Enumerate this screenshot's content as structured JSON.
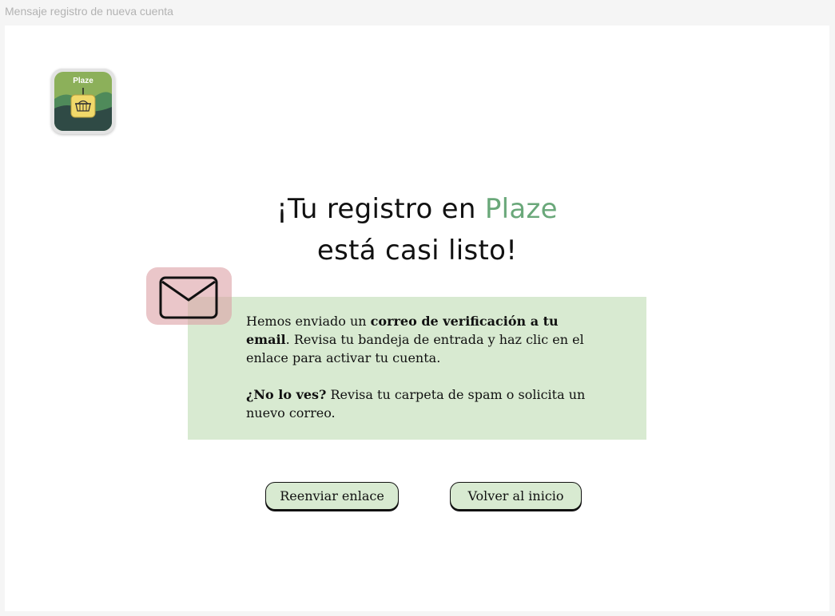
{
  "frame": {
    "label": "Mensaje registro de nueva cuenta"
  },
  "app_icon": {
    "label": "Plaze",
    "icon": "shopping-basket-icon"
  },
  "headline": {
    "prefix": "¡Tu registro en ",
    "brand": "Plaze",
    "line2": "está casi listo!"
  },
  "info": {
    "icon": "envelope-icon",
    "p1_before": "Hemos enviado un ",
    "p1_bold": "correo de verificación a tu email",
    "p1_after": ". Revisa tu bandeja de entrada y haz clic en el enlace para activar tu cuenta.",
    "p2_bold": "¿No lo ves?",
    "p2_after": " Revisa tu carpeta de spam o solicita un nuevo correo."
  },
  "buttons": {
    "resend": "Reenviar enlace",
    "home": "Volver al inicio"
  },
  "colors": {
    "brand_green": "#6aa87a",
    "card_green": "#d8ead1",
    "badge_pink": "#dca0a5"
  }
}
